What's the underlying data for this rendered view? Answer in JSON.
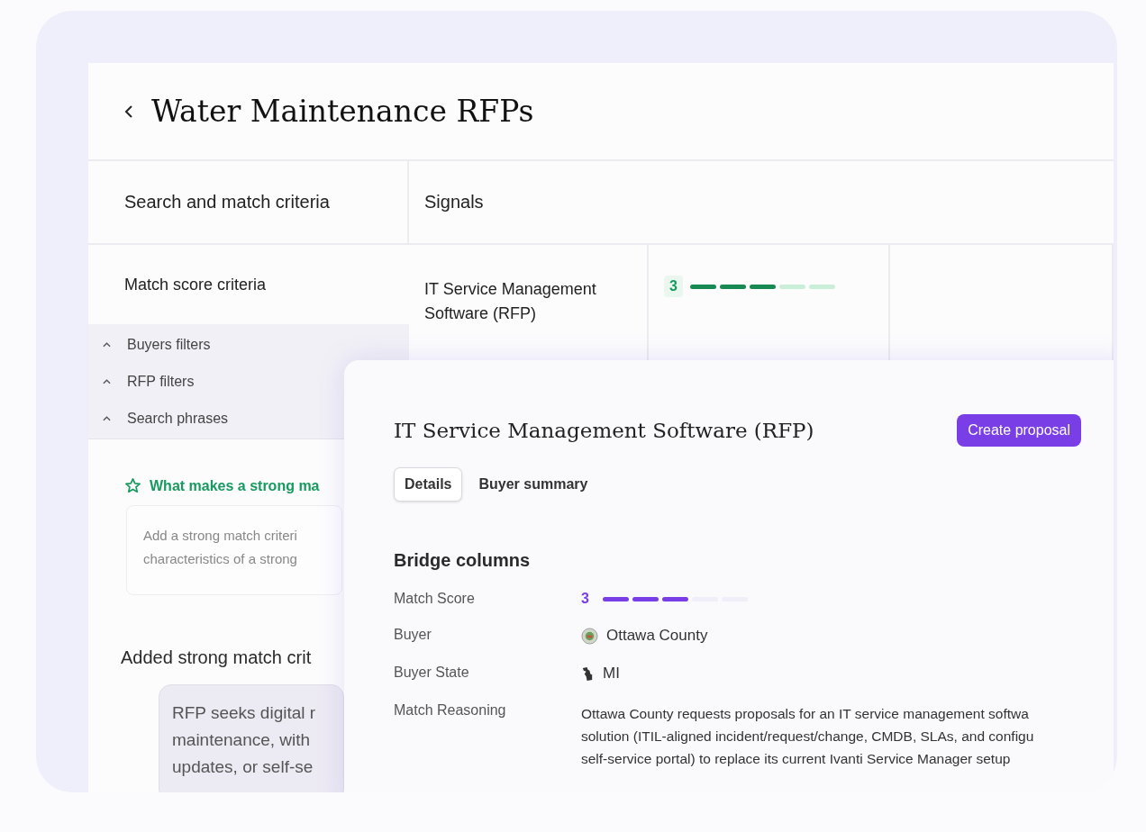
{
  "page": {
    "title": "Water Maintenance RFPs"
  },
  "columns": [
    "Search and match criteria",
    "Signals"
  ],
  "criteria": {
    "heading": "Match score criteria",
    "sections": [
      {
        "label": "Buyers filters",
        "expanded": true
      },
      {
        "label": "RFP filters",
        "expanded": true
      },
      {
        "label": "Search phrases",
        "expanded": true
      }
    ],
    "strong_match": {
      "heading": "What makes a strong ma",
      "placeholder": "Add a strong match criteri\ncharacteristics of a strong"
    },
    "added": {
      "heading": "Added strong match crit",
      "text": "RFP seeks digital r\nmaintenance, with\nupdates, or self-se"
    }
  },
  "signals": [
    {
      "name": "IT Service Management\nSoftware (RFP)",
      "score": "3",
      "level": 0.6
    }
  ],
  "detail": {
    "title": "IT Service Management Software (RFP)",
    "action": "Create proposal",
    "tabs": [
      {
        "label": "Details",
        "selected": true
      },
      {
        "label": "Buyer summary",
        "selected": false
      }
    ],
    "section": "Bridge columns",
    "fields": [
      {
        "kind": "score",
        "label": "Match Score",
        "value": "3",
        "level": 0.6
      },
      {
        "kind": "buyer",
        "label": "Buyer",
        "value": "Ottawa County"
      },
      {
        "kind": "state",
        "label": "Buyer State",
        "value": "MI"
      },
      {
        "kind": "text",
        "label": "Match Reasoning",
        "value": "Ottawa County requests proposals for an IT service management softwa\nsolution (ITIL-aligned incident/request/change, CMDB, SLAs, and configu\nself-service portal) to replace its current Ivanti Service Manager setup"
      }
    ]
  }
}
